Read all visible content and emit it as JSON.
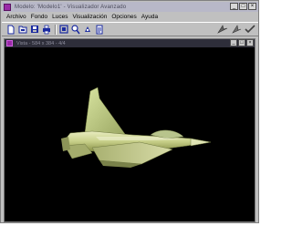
{
  "window": {
    "title": "Modelo: 'Modelo1' - Visualizador Avanzado",
    "controls": {
      "minimize": "_",
      "maximize": "□",
      "close": "×"
    }
  },
  "menubar": {
    "items": [
      {
        "label": "Archivo"
      },
      {
        "label": "Fondo"
      },
      {
        "label": "Luces"
      },
      {
        "label": "Visualización"
      },
      {
        "label": "Opciones"
      },
      {
        "label": "Ayuda"
      }
    ]
  },
  "toolbar": {
    "buttons": [
      {
        "icon": "new-file-icon"
      },
      {
        "icon": "open-file-icon"
      },
      {
        "icon": "save-icon"
      },
      {
        "icon": "print-icon"
      },
      {
        "icon": "transform-icon"
      },
      {
        "icon": "zoom-icon"
      },
      {
        "icon": "rotate-icon"
      },
      {
        "icon": "info-icon"
      },
      {
        "icon": "pointer-icon"
      },
      {
        "icon": "light-icon"
      },
      {
        "icon": "check-icon"
      }
    ]
  },
  "child_window": {
    "title": "Vista - 584 x 384 - 4/4",
    "controls": {
      "minimize": "_",
      "maximize": "□",
      "close": "×"
    }
  },
  "viewport": {
    "model": "fighter-jet-3d-model",
    "background_color": "#000000"
  },
  "colors": {
    "app_icon": "#9a2aa8",
    "title_bar": "#b8b8c8",
    "chrome": "#c0c0c0",
    "toolbar_icon_blue": "#1a2aa0"
  }
}
